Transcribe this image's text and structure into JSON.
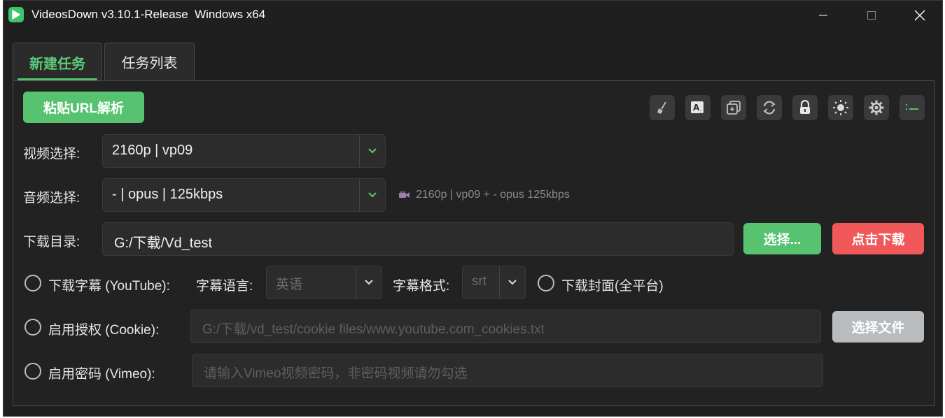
{
  "window": {
    "title": "VideosDown v3.10.1-Release  Windows x64",
    "logo_icon": "play-logo-icon",
    "controls": [
      "minimize-icon",
      "maximize-icon",
      "close-icon"
    ]
  },
  "tabs": [
    {
      "label": "新建任务",
      "active": true
    },
    {
      "label": "任务列表",
      "active": false
    }
  ],
  "toolbar": {
    "paste_label": "粘贴URL解析",
    "tools": [
      "broom-icon",
      "subtitle-icon",
      "copy-icon",
      "refresh-icon",
      "lock-icon",
      "sun-icon",
      "gear-icon",
      "list-icon"
    ]
  },
  "video": {
    "label": "视频选择:",
    "value": "2160p | vp09"
  },
  "audio": {
    "label": "音频选择:",
    "value": "- | opus | 125kbps",
    "summary": "2160p | vp09 + - opus 125kbps",
    "summary_icon": "video-camera-icon"
  },
  "directory": {
    "label": "下载目录:",
    "value": "G:/下载/Vd_test",
    "choose_label": "选择...",
    "download_label": "点击下载"
  },
  "subtitle": {
    "checkbox_label": "下载字幕 (YouTube):",
    "language_label": "字幕语言:",
    "language_value": "英语",
    "format_label": "字幕格式:",
    "format_value": "srt",
    "cover_label": "下载封面(全平台)"
  },
  "cookie": {
    "checkbox_label": "启用授权 (Cookie):",
    "path_placeholder": "G:/下载/vd_test/cookie files/www.youtube.com_cookies.txt",
    "file_button_label": "选择文件"
  },
  "vimeo": {
    "checkbox_label": "启用密码 (Vimeo):",
    "password_placeholder": "请输入Vimeo视频密码，非密码视频请勿勾选"
  },
  "colors": {
    "accent_green": "#57c26f",
    "download_red": "#f0585a",
    "disabled_gray": "#b9bcbf",
    "background": "#1f1f1f"
  }
}
